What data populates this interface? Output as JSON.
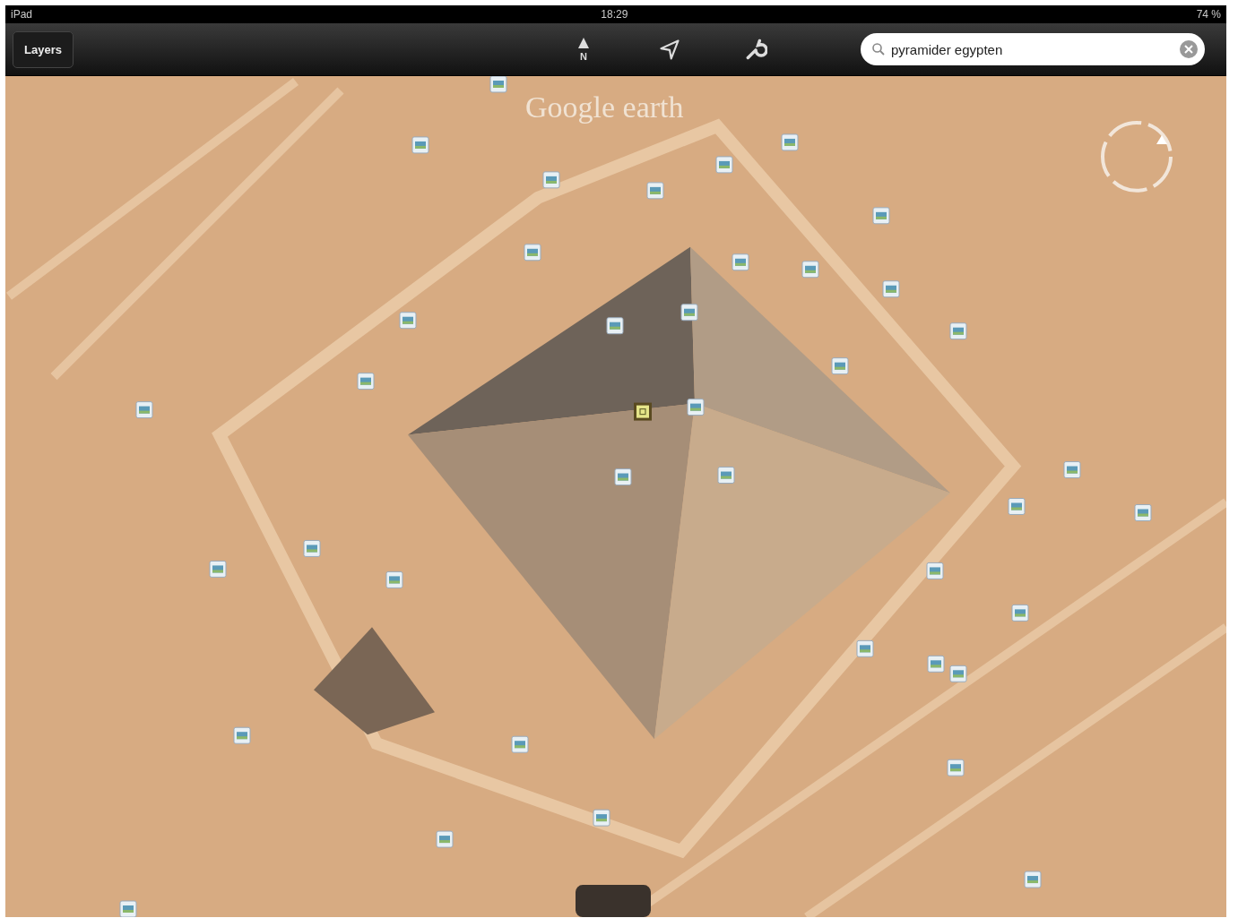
{
  "status_bar": {
    "device": "iPad",
    "time": "18:29",
    "battery": "74 %"
  },
  "toolbar": {
    "layers_button": "Layers",
    "north_label": "N",
    "search": {
      "value": "pyramider egypten"
    }
  },
  "map": {
    "logo": "Google earth"
  }
}
